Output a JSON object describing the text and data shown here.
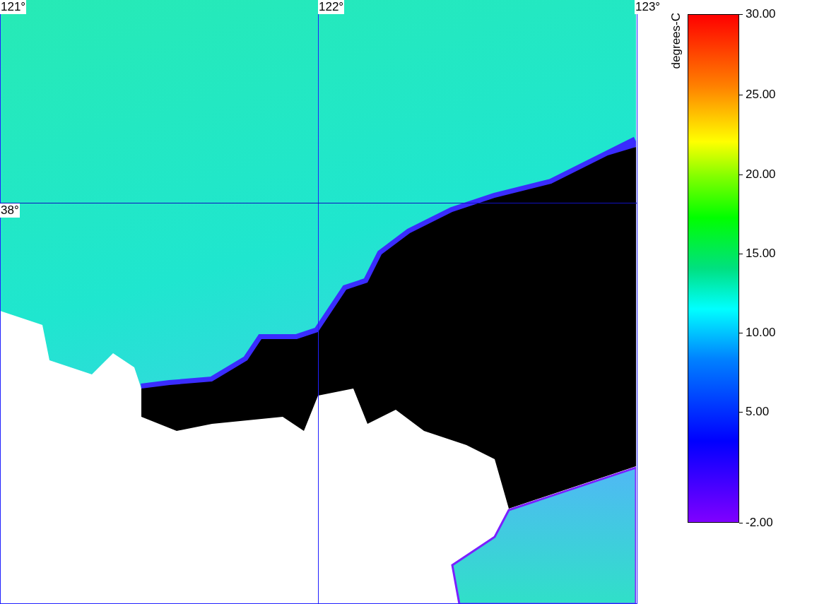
{
  "map": {
    "longitude_labels": [
      "121°",
      "122°",
      "123°"
    ],
    "latitude_labels": [
      "38°"
    ]
  },
  "legend": {
    "unit": "degrees-C",
    "ticks": [
      "30.00",
      "25.00",
      "20.00",
      "15.00",
      "10.00",
      "5.00",
      "-2.00"
    ]
  }
}
